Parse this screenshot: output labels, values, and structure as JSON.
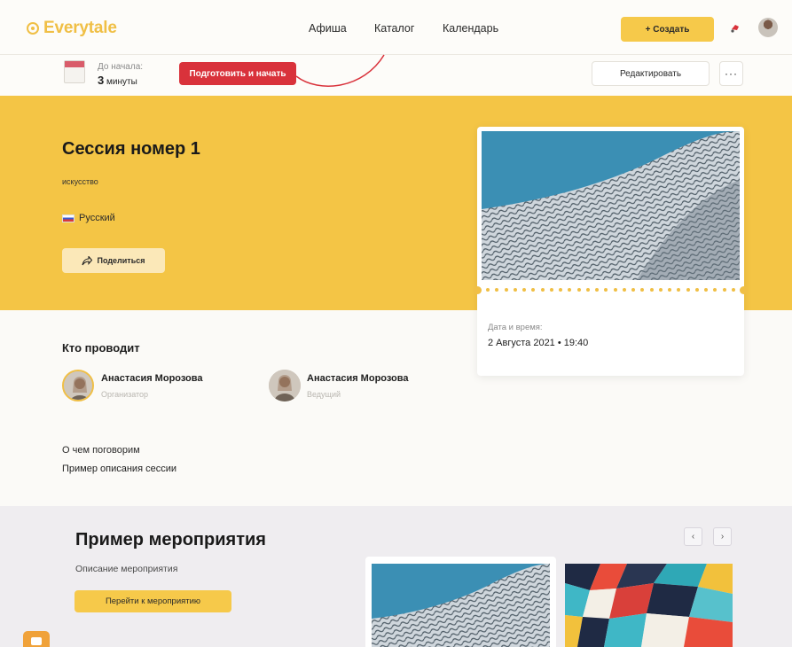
{
  "header": {
    "logo_text": "Everytale",
    "nav": [
      "Афиша",
      "Каталог",
      "Календарь"
    ],
    "create_label": "+ Создать"
  },
  "session_bar": {
    "countdown_label": "До начала:",
    "countdown_value": "3",
    "countdown_unit": "минуты",
    "prepare_label": "Подготовить и начать",
    "edit_label": "Редактировать",
    "more_label": "···"
  },
  "session": {
    "title": "Сессия номер 1",
    "category": "искусство",
    "language": "Русский",
    "share_label": "Поделиться",
    "datetime_label": "Дата и время:",
    "datetime_value": "2 Августа 2021 • 19:40"
  },
  "hosts": {
    "title": "Кто проводит",
    "people": [
      {
        "name": "Анастасия Морозова",
        "role": "Организатор"
      },
      {
        "name": "Анастасия Морозова",
        "role": "Ведущий"
      }
    ]
  },
  "about": {
    "title": "О чем поговорим",
    "text": "Пример описания сессии"
  },
  "event": {
    "title": "Пример мероприятия",
    "description": "Описание мероприятия",
    "goto_label": "Перейти к мероприятию",
    "prev_icon": "‹",
    "next_icon": "›"
  },
  "colors": {
    "accent": "#f4c545",
    "danger": "#d9323b",
    "logo": "#f0bf45"
  }
}
